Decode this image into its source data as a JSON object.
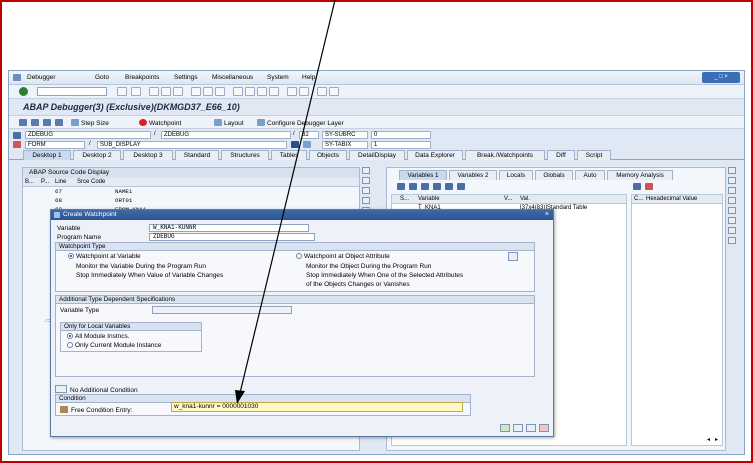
{
  "menu": [
    "Debugger",
    "Goto",
    "Breakpoints",
    "Settings",
    "Miscellaneous",
    "System",
    "Help"
  ],
  "title": "ABAP Debugger(3)  (Exclusive)(DKMGD37_E66_10)",
  "app_toolbar": {
    "step_size": "Step Size",
    "watchpoint": "Watchpoint",
    "layout": "Layout",
    "configure": "Configure Debugger Layer"
  },
  "header": {
    "prog1": "ZDEBUG",
    "prog2": "ZDEBUG",
    "line1": "82",
    "sysvar1": "SY-SUBRC",
    "sysval1": "0",
    "type": "FORM",
    "name": "SUB_DISPLAY",
    "sysvar2": "SY-TABIX",
    "sysval2": "1"
  },
  "tabs": [
    "Desktop 1",
    "Desktop 2",
    "Desktop 3",
    "Standard",
    "Structures",
    "Tables",
    "Objects",
    "DetailDisplay",
    "Data Explorer",
    "Break./Watchpoints",
    "Diff",
    "Script"
  ],
  "source": {
    "title": "ABAP Source Code Display",
    "cols": [
      "B...",
      "P...",
      "Line",
      "Srce Code"
    ],
    "rows": [
      {
        "line": "67",
        "code": "NAME1"
      },
      {
        "line": "68",
        "code": "ORT01"
      },
      {
        "line": "69",
        "code": "FROM KNA1"
      }
    ]
  },
  "vars": {
    "tabs": [
      "Variables 1",
      "Variables 2",
      "Locals",
      "Globals",
      "Auto",
      "Memory Analysis"
    ],
    "cols": [
      "S...",
      "Variable",
      "V...",
      "Val.",
      "C...",
      "Hexadecimal Value"
    ],
    "rows": [
      {
        "variable": "T_KNA1",
        "value": "[37x4(83)]Standard Table"
      }
    ]
  },
  "dialog": {
    "title": "Create Watchpoint",
    "variable_label": "Variable",
    "variable_value": "W_KNA1-KUNNR",
    "program_label": "Program Name",
    "program_value": "ZDEBUG",
    "type_group": "Watchpoint Type",
    "opt1_title": "Watchpoint at Variable",
    "opt1_l1": "Monitor the Variable During the Program Run",
    "opt1_l2": "Stop Immediately When Value of Variable Changes",
    "opt2_title": "Watchpoint at Object Attribute",
    "opt2_l1": "Monitor the Object During the Program Run",
    "opt2_l2": "Stop Immediately When One of the Selected Attributes",
    "opt2_l3": "of the Objects Changes or Vanishes",
    "spec_group": "Additional Type Dependent Specifications",
    "vartype_label": "Variable Type",
    "local_group": "Only for Local Variables",
    "local1": "All Module Instncs.",
    "local2": "Only Current Module Instance",
    "no_cond": "No Additional Condition",
    "cond_group": "Condition",
    "free_label": "Free Condition Entry:",
    "free_value": "w_kna1-kunnr = 0000001030"
  }
}
